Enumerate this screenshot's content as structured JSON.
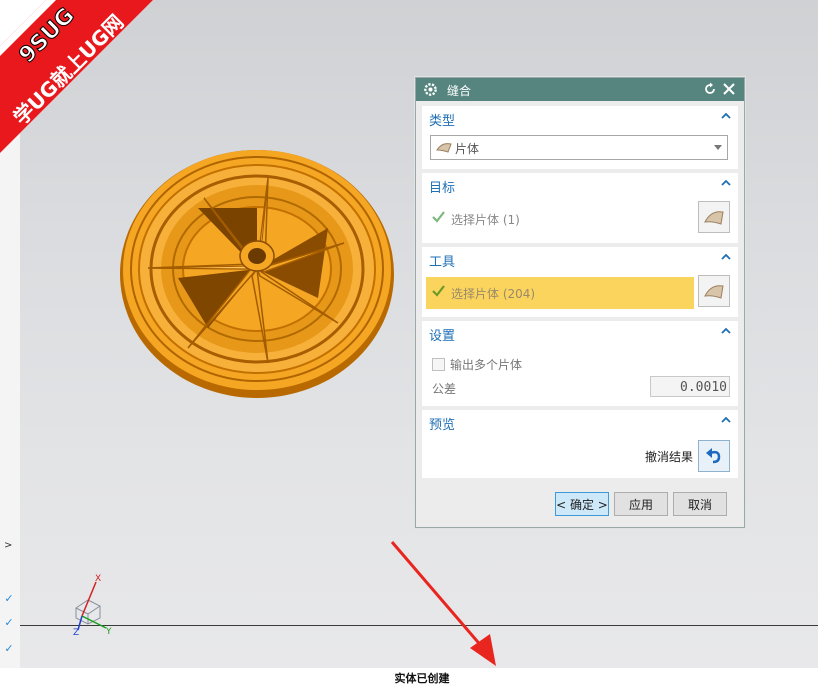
{
  "watermark": {
    "line1": "9SUG",
    "line2": "学UG就上UG网"
  },
  "dialog": {
    "title": "缝合",
    "sections": {
      "type": {
        "header": "类型",
        "value": "片体"
      },
      "target": {
        "header": "目标",
        "select_label": "选择片体 (1)"
      },
      "tool": {
        "header": "工具",
        "select_label": "选择片体 (204)"
      },
      "settings": {
        "header": "设置",
        "multi_output_label": "输出多个片体",
        "tolerance_label": "公差",
        "tolerance_value": "0.0010"
      },
      "preview": {
        "header": "预览",
        "undo_label": "撤消结果"
      }
    },
    "buttons": {
      "ok": "< 确定 >",
      "apply": "应用",
      "cancel": "取消"
    }
  },
  "viewport": {
    "axes": {
      "x": "X",
      "y": "Y",
      "z": "Z"
    }
  },
  "status": {
    "text": "实体已创建"
  },
  "colors": {
    "title_bar": "#56857f",
    "header_text": "#1f6fb5",
    "highlight": "#fbd45d",
    "model": "#f5a623",
    "arrow": "#e8251f"
  },
  "icons": [
    "gear-icon",
    "reset-icon",
    "close-icon",
    "chevron-up-icon",
    "sheet-body-icon",
    "check-icon",
    "face-select-icon",
    "undo-icon"
  ]
}
